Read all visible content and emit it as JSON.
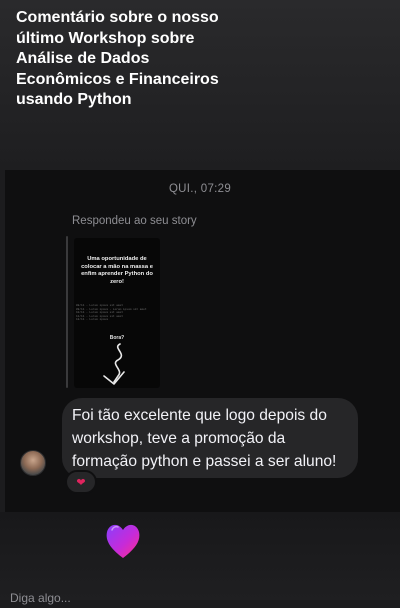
{
  "story_header": {
    "title": "Comentário sobre o nosso último Workshop sobre Análise de Dados Econômicos e Financeiros usando Python"
  },
  "conversation": {
    "timestamp": "QUI., 07:29",
    "reply_label": "Respondeu ao seu story",
    "story_preview": {
      "headline": "Uma oportunidade de colocar a mão na massa e enfim aprender Python do zero!",
      "lines": [
        "08/11 - Lorem ipsum sit amet",
        "09/11 - Lorem ipsum - Lorem ipsum sit amet",
        "10/11 - Lorem ipsum sit amet",
        "11/11 - Lorem ipsum sit amet",
        "12/11 - Lorem ipsum"
      ],
      "cta": "Bora?"
    },
    "message": {
      "text": "Foi tão excelente que logo depois do workshop, teve a promoção da formação python e passei a ser aluno!",
      "reaction": "❤"
    },
    "sticker": "heart-sticker"
  },
  "composer": {
    "placeholder": "Diga algo..."
  },
  "colors": {
    "background": "#1c1c1e",
    "chat_background": "#0f0f10",
    "bubble": "#262628",
    "muted_text": "#8e8e93",
    "reaction": "#e0245e",
    "sticker_gradient": [
      "#8a3ffc",
      "#ff2d8a"
    ]
  }
}
